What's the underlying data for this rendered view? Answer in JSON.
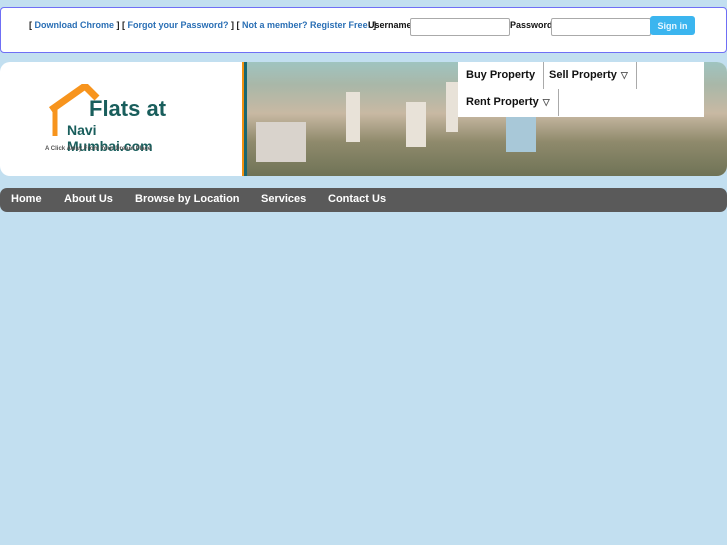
{
  "topbar": {
    "links": [
      "Download Chrome",
      "Forgot your Password?",
      "Not a member? Register Free!"
    ],
    "username_label": "Username",
    "password_label": "Password",
    "username_value": "",
    "password_value": "",
    "signin": "Sign in"
  },
  "logo": {
    "line1": "Flats at",
    "line2": "Navi Mumbai.com",
    "tagline": "A Click Away From Your Dream Place"
  },
  "property_menu": [
    "Buy Property",
    "Sell Property",
    "Rent Property"
  ],
  "nav": [
    "Home",
    "About Us",
    "Browse by Location",
    "Services",
    "Contact Us"
  ],
  "colors": {
    "link": "#2a6fb5",
    "signin": "#3bb5ef",
    "nav": "#5a5a5a",
    "background": "#c2dff0"
  }
}
